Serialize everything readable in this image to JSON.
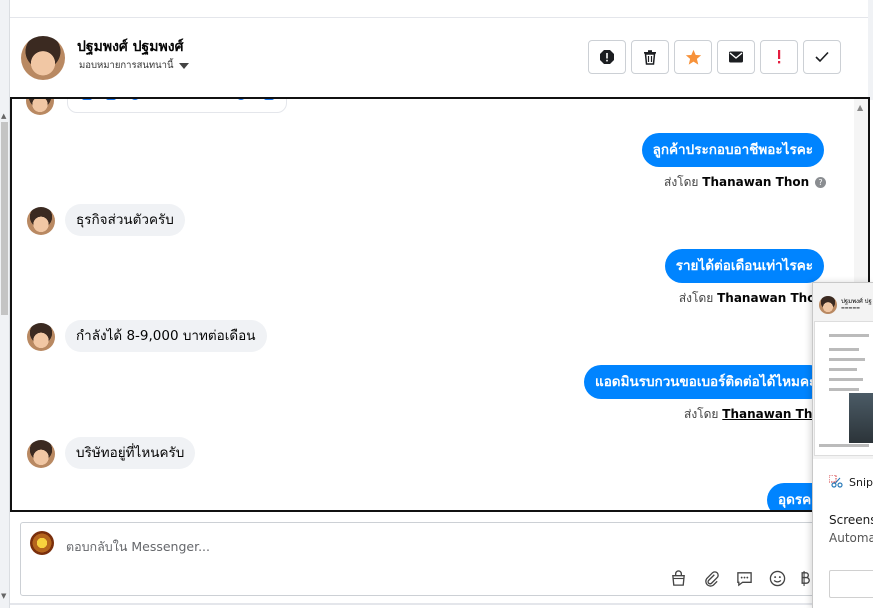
{
  "header": {
    "contact_name": "ปฐมพงศ์ ปฐมพงศ์",
    "assign_label": "มอบหมายการสนทนานี้",
    "actions": [
      {
        "name": "spam-icon"
      },
      {
        "name": "trash-icon"
      },
      {
        "name": "star-icon"
      },
      {
        "name": "mail-icon"
      },
      {
        "name": "exclamation-icon"
      },
      {
        "name": "check-icon"
      }
    ]
  },
  "messages": [
    {
      "side": "out",
      "text": "ลูกค้าประกอบอาชีพอะไรคะ",
      "sent_by_prefix": "ส่งโดย",
      "sender": "Thanawan Thon",
      "help": true
    },
    {
      "side": "in",
      "text": "ธุรกิจส่วนตัวครับ"
    },
    {
      "side": "out",
      "text": "รายได้ต่อเดือนเท่าไรคะ",
      "sent_by_prefix": "ส่งโดย",
      "sender": "Thanawan Thon"
    },
    {
      "side": "in",
      "text": "กำลังได้ 8-9,000 บาทต่อเดือน"
    },
    {
      "side": "out",
      "text": "แอดมินรบกวนขอเบอร์ติดต่อได้ไหมคะ",
      "sent_by_prefix": "ส่งโดย",
      "sender": "Thanawan Thon"
    },
    {
      "side": "in",
      "text": "บริษัทอยู่ที่ไหนครับ"
    },
    {
      "side": "out",
      "text": "อุดรคะ"
    }
  ],
  "reply": {
    "placeholder": "ตอบกลับใน Messenger..."
  },
  "snip_overlay": {
    "thumb_name": "ปฐมพงศ์ ปฐ",
    "app_name": "Snip",
    "title": "Screens",
    "subtitle": "Automa"
  },
  "colors": {
    "accent": "#0084ff",
    "incoming_bubble": "#f0f2f5",
    "star": "#f7923a",
    "alert": "#e41e3f"
  }
}
